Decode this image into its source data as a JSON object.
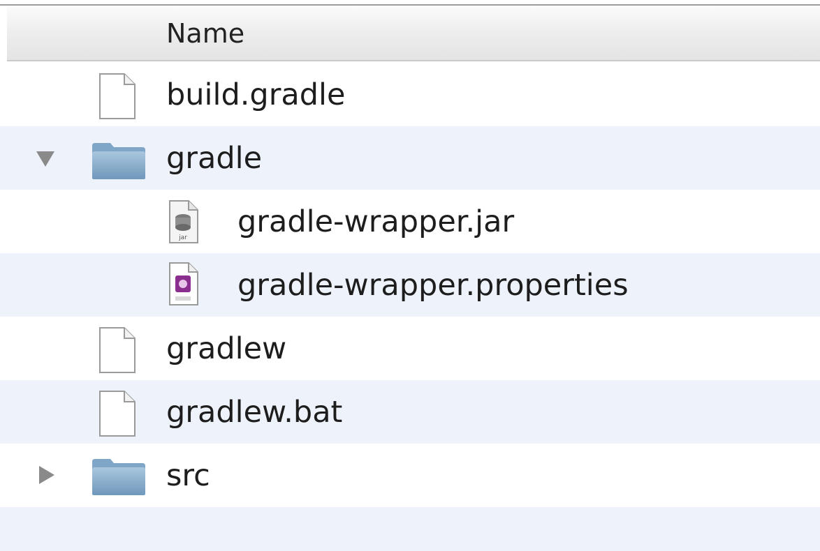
{
  "header": {
    "name_column": "Name"
  },
  "rows": [
    {
      "name": "build.gradle",
      "icon": "document-icon",
      "depth": 0,
      "disclosure": "none"
    },
    {
      "name": "gradle",
      "icon": "folder-icon",
      "depth": 0,
      "disclosure": "expanded"
    },
    {
      "name": "gradle-wrapper.jar",
      "icon": "jar-file-icon",
      "depth": 1,
      "disclosure": "none"
    },
    {
      "name": "gradle-wrapper.properties",
      "icon": "properties-file-icon",
      "depth": 1,
      "disclosure": "none"
    },
    {
      "name": "gradlew",
      "icon": "document-icon",
      "depth": 0,
      "disclosure": "none"
    },
    {
      "name": "gradlew.bat",
      "icon": "document-icon",
      "depth": 0,
      "disclosure": "none"
    },
    {
      "name": "src",
      "icon": "folder-icon",
      "depth": 0,
      "disclosure": "collapsed"
    }
  ],
  "colors": {
    "row_alternate": "#eef3fb",
    "folder_blue": "#7fa6c6",
    "disclosure_gray": "#8a8a8a",
    "properties_purple": "#8a2f8f"
  }
}
